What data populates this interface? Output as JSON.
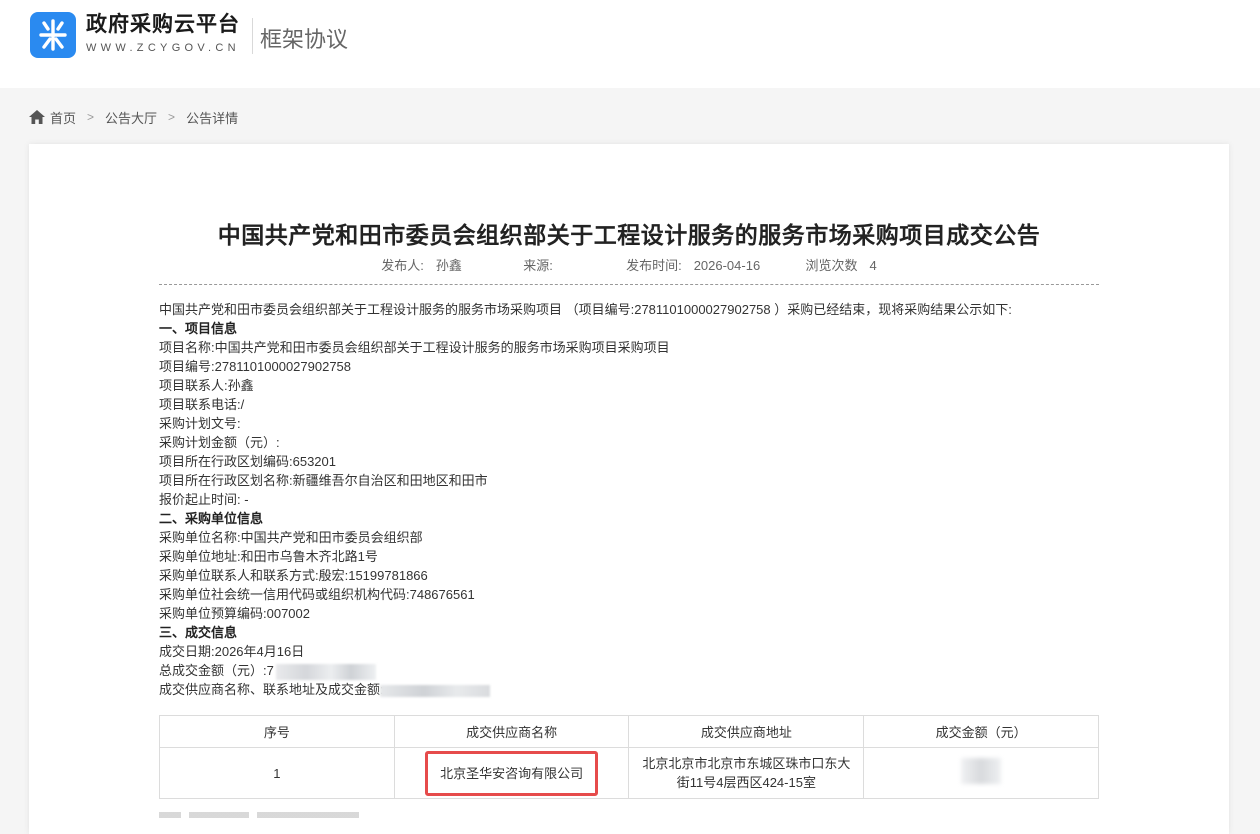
{
  "header": {
    "logo_title": "政府采购云平台",
    "logo_sub": "WWW.ZCYGOV.CN",
    "section_title": "框架协议",
    "brand_color": "#2a8af0"
  },
  "breadcrumb": {
    "home": "首页",
    "hall": "公告大厅",
    "detail": "公告详情"
  },
  "article": {
    "title": "中国共产党和田市委员会组织部关于工程设计服务的服务市场采购项目成交公告",
    "meta": {
      "publisher_label": "发布人:",
      "publisher": "孙鑫",
      "source_label": "来源:",
      "source": "",
      "time_label": "发布时间:",
      "time": "2026-04-16",
      "views_label": "浏览次数",
      "views": "4"
    },
    "intro": "中国共产党和田市委员会组织部关于工程设计服务的服务市场采购项目 （项目编号:2781101000027902758 ）采购已经结束，现将采购结果公示如下:",
    "section1": "一、项目信息",
    "project_name": "项目名称:中国共产党和田市委员会组织部关于工程设计服务的服务市场采购项目采购项目",
    "project_no": "项目编号:2781101000027902758",
    "contact": "项目联系人:孙鑫",
    "phone": "项目联系电话:/",
    "plan_no": "采购计划文号:",
    "plan_amount": "采购计划金额（元）:",
    "region_code": "项目所在行政区划编码:653201",
    "region_name": "项目所在行政区划名称:新疆维吾尔自治区和田地区和田市",
    "quote_time": "报价起止时间: -",
    "section2": "二、采购单位信息",
    "buyer_name": "采购单位名称:中国共产党和田市委员会组织部",
    "buyer_addr": "采购单位地址:和田市乌鲁木齐北路1号",
    "buyer_contact": "采购单位联系人和联系方式:殷宏:15199781866",
    "buyer_credit": "采购单位社会统一信用代码或组织机构代码:748676561",
    "buyer_budget": "采购单位预算编码:007002",
    "section3": "三、成交信息",
    "deal_date": "成交日期:2026年4月16日",
    "total_amount_label": "总成交金额（元）:7",
    "supplier_info": "成交供应商名称、联系地址及成交金额:"
  },
  "table": {
    "headers": [
      "序号",
      "成交供应商名称",
      "成交供应商地址",
      "成交金额（元）"
    ],
    "rows": [
      {
        "no": "1",
        "name": "北京圣华安咨询有限公司",
        "address": "北京北京市北京市东城区珠市口东大街11号4层西区424-15室",
        "amount": ""
      }
    ]
  }
}
